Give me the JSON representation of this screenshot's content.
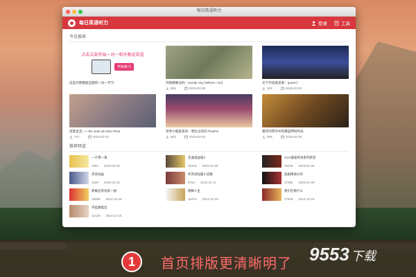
{
  "window": {
    "title": "每日英语听力"
  },
  "appbar": {
    "name": "每日英语听力",
    "login": "登录",
    "tools": "工具"
  },
  "sections": {
    "today": "今日推荐",
    "recommended": "推荐频道"
  },
  "promo": {
    "text": "点击立刻开始一对一和外教说英语",
    "button": "开始练习"
  },
  "today_items": [
    {
      "title": "这些外教都超全面的一对一学习",
      "downloads": "",
      "date": ""
    },
    {
      "title": "开始聊聊过的：Donde Voy (Where I Go)",
      "downloads": "606",
      "date": "2015-02-06"
    },
    {
      "title": "天下外语爱美者：queen？",
      "downloads": "303",
      "date": "2015-02-02"
    },
    {
      "title": "宠爱生活——De Juan de Dios Pesa",
      "downloads": "707",
      "date": "2015-02-04"
    },
    {
      "title": "世界小姐爱美的：帮忙过去的 Pauline",
      "downloads": "563",
      "date": "2015-02-03"
    },
    {
      "title": "童年的琴声中的那些特别时光",
      "downloads": "806",
      "date": "2015-02-05"
    }
  ],
  "rec_items": [
    {
      "title": "一千零一夜",
      "downloads": "7562",
      "date": "2015-02-02"
    },
    {
      "title": "走遍美国第2",
      "downloads": "10418",
      "date": "2015-01-29"
    },
    {
      "title": "VOA慢速英语系列原音",
      "downloads": "28239",
      "date": "2015-01-26"
    },
    {
      "title": "英语动画",
      "downloads": "1026",
      "date": "2015-01-21"
    },
    {
      "title": "听英语短篇小说集",
      "downloads": "5753",
      "date": "2015-01-17"
    },
    {
      "title": "美剧精讲分享",
      "downloads": "37284",
      "date": "2015-01-09"
    },
    {
      "title": "新概念英语第一册",
      "downloads": "19089",
      "date": "2014-12-26"
    },
    {
      "title": "随聊人生",
      "downloads": "15372",
      "date": "2014-12-19"
    },
    {
      "title": "我们在看什么",
      "downloads": "17936",
      "date": "2014-12-16"
    },
    {
      "title": "牙齿跟着念",
      "downloads": "12128",
      "date": "2014-12-15"
    }
  ],
  "banner": {
    "number": "1",
    "text": "首页排版更清晰明了",
    "watermark": "9553",
    "watermark_sub": "下载"
  }
}
